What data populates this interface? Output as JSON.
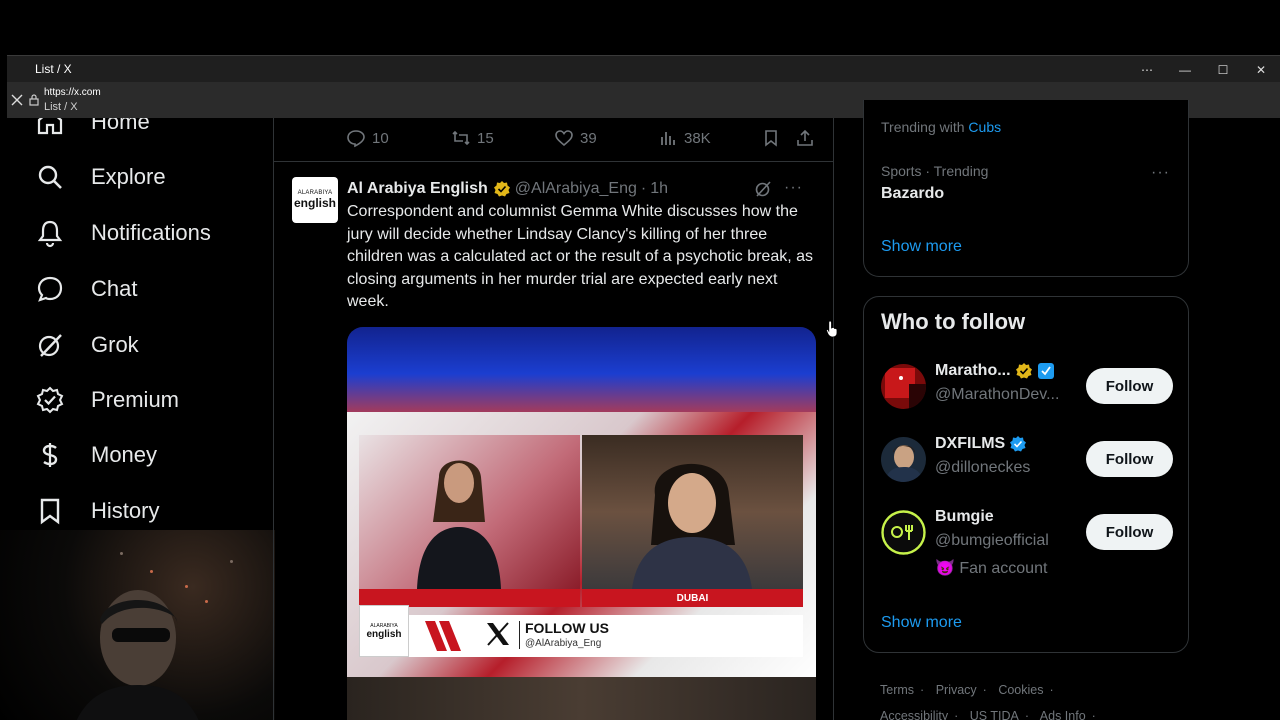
{
  "window": {
    "title": "List / X",
    "controls": [
      "⋯",
      "—",
      "☐",
      "✕"
    ]
  },
  "urlbar": {
    "url": "https://x.com",
    "subtitle": "List / X"
  },
  "nav": {
    "items": [
      {
        "label": "Home",
        "icon": "home-icon"
      },
      {
        "label": "Explore",
        "icon": "search-icon"
      },
      {
        "label": "Notifications",
        "icon": "bell-icon"
      },
      {
        "label": "Chat",
        "icon": "chat-icon"
      },
      {
        "label": "Grok",
        "icon": "grok-icon"
      },
      {
        "label": "Premium",
        "icon": "premium-icon"
      },
      {
        "label": "Money",
        "icon": "money-icon"
      },
      {
        "label": "History",
        "icon": "bookmark-icon"
      }
    ]
  },
  "prev_tweet_actions": {
    "replies": "10",
    "reposts": "15",
    "likes": "39",
    "views": "38K"
  },
  "tweet": {
    "avatar_line1": "ALARABIYA",
    "avatar_line2": "english",
    "name": "Al Arabiya English",
    "handle": "@AlArabiya_Eng",
    "dot": "·",
    "time": "1h",
    "more": "···",
    "text": "Correspondent and columnist Gemma White discusses how the jury will decide whether Lindsay Clancy's killing of her three children was a calculated act or the result of a psychotic break, as closing arguments in her murder trial are expected early next week.",
    "media": {
      "location_tag": "DUBAI",
      "logo_line1": "ALARABIYA",
      "logo_line2": "english",
      "follow_us": "FOLLOW US",
      "follow_handle": "@AlArabiya_Eng"
    }
  },
  "trends": {
    "trending_with_prefix": "Trending with ",
    "trending_with_topic": "Cubs",
    "category": "Sports · Trending",
    "name": "Bazardo",
    "more": "···",
    "show_more": "Show more"
  },
  "who_to_follow": {
    "title": "Who to follow",
    "accounts": [
      {
        "name": "Maratho...",
        "handle": "@MarathonDev...",
        "extra": "",
        "button": "Follow"
      },
      {
        "name": "DXFILMS",
        "handle": "@dilloneckes",
        "extra": "",
        "button": "Follow"
      },
      {
        "name": "Bumgie",
        "handle": "@bumgieofficial",
        "extra": "😈 Fan account",
        "button": "Follow"
      }
    ],
    "show_more": "Show more"
  },
  "footer": {
    "links": [
      "Terms",
      "Privacy",
      "Cookies",
      "Accessibility",
      "US TIDA",
      "Ads Info"
    ],
    "separator": "·"
  },
  "colors": {
    "accent": "#1d9bf0",
    "background": "#000000",
    "border": "#2f3336",
    "muted": "#71767b",
    "verified_gold": "#f4c542",
    "verified_blue": "#1d9bf0"
  }
}
